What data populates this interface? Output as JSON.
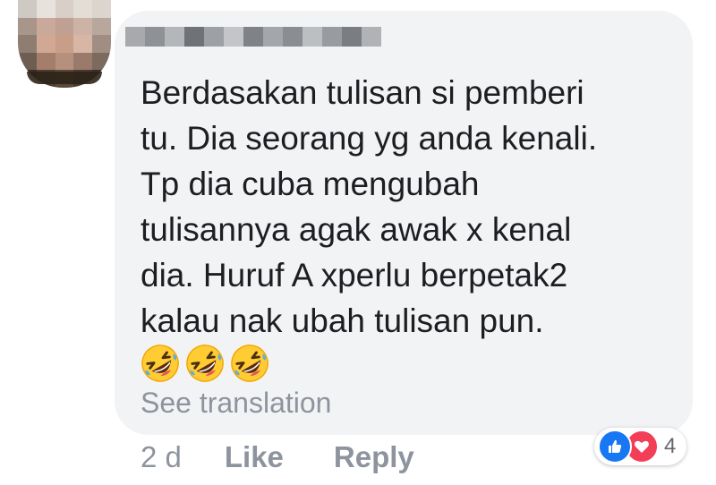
{
  "comment": {
    "author_name": "",
    "lines": [
      "Berdasakan tulisan si pemberi",
      "tu. Dia seorang yg anda kenali.",
      "Tp dia cuba mengubah",
      "tulisannya agak awak x kenal",
      "dia. Huruf A xperlu berpetak2",
      "kalau nak ubah tulisan pun."
    ],
    "emojis": [
      "rolling-on-floor-laughing",
      "rolling-on-floor-laughing",
      "rolling-on-floor-laughing"
    ],
    "see_translation": "See translation"
  },
  "actions": {
    "time": "2 d",
    "like": "Like",
    "reply": "Reply"
  },
  "reactions": {
    "types": [
      "like",
      "love"
    ],
    "count": "4"
  },
  "colors": {
    "bubble": "#f2f3f5",
    "text": "#1c1e21",
    "muted": "#8d949e",
    "like_blue": "#1877f2",
    "love_red": "#f33e58"
  }
}
